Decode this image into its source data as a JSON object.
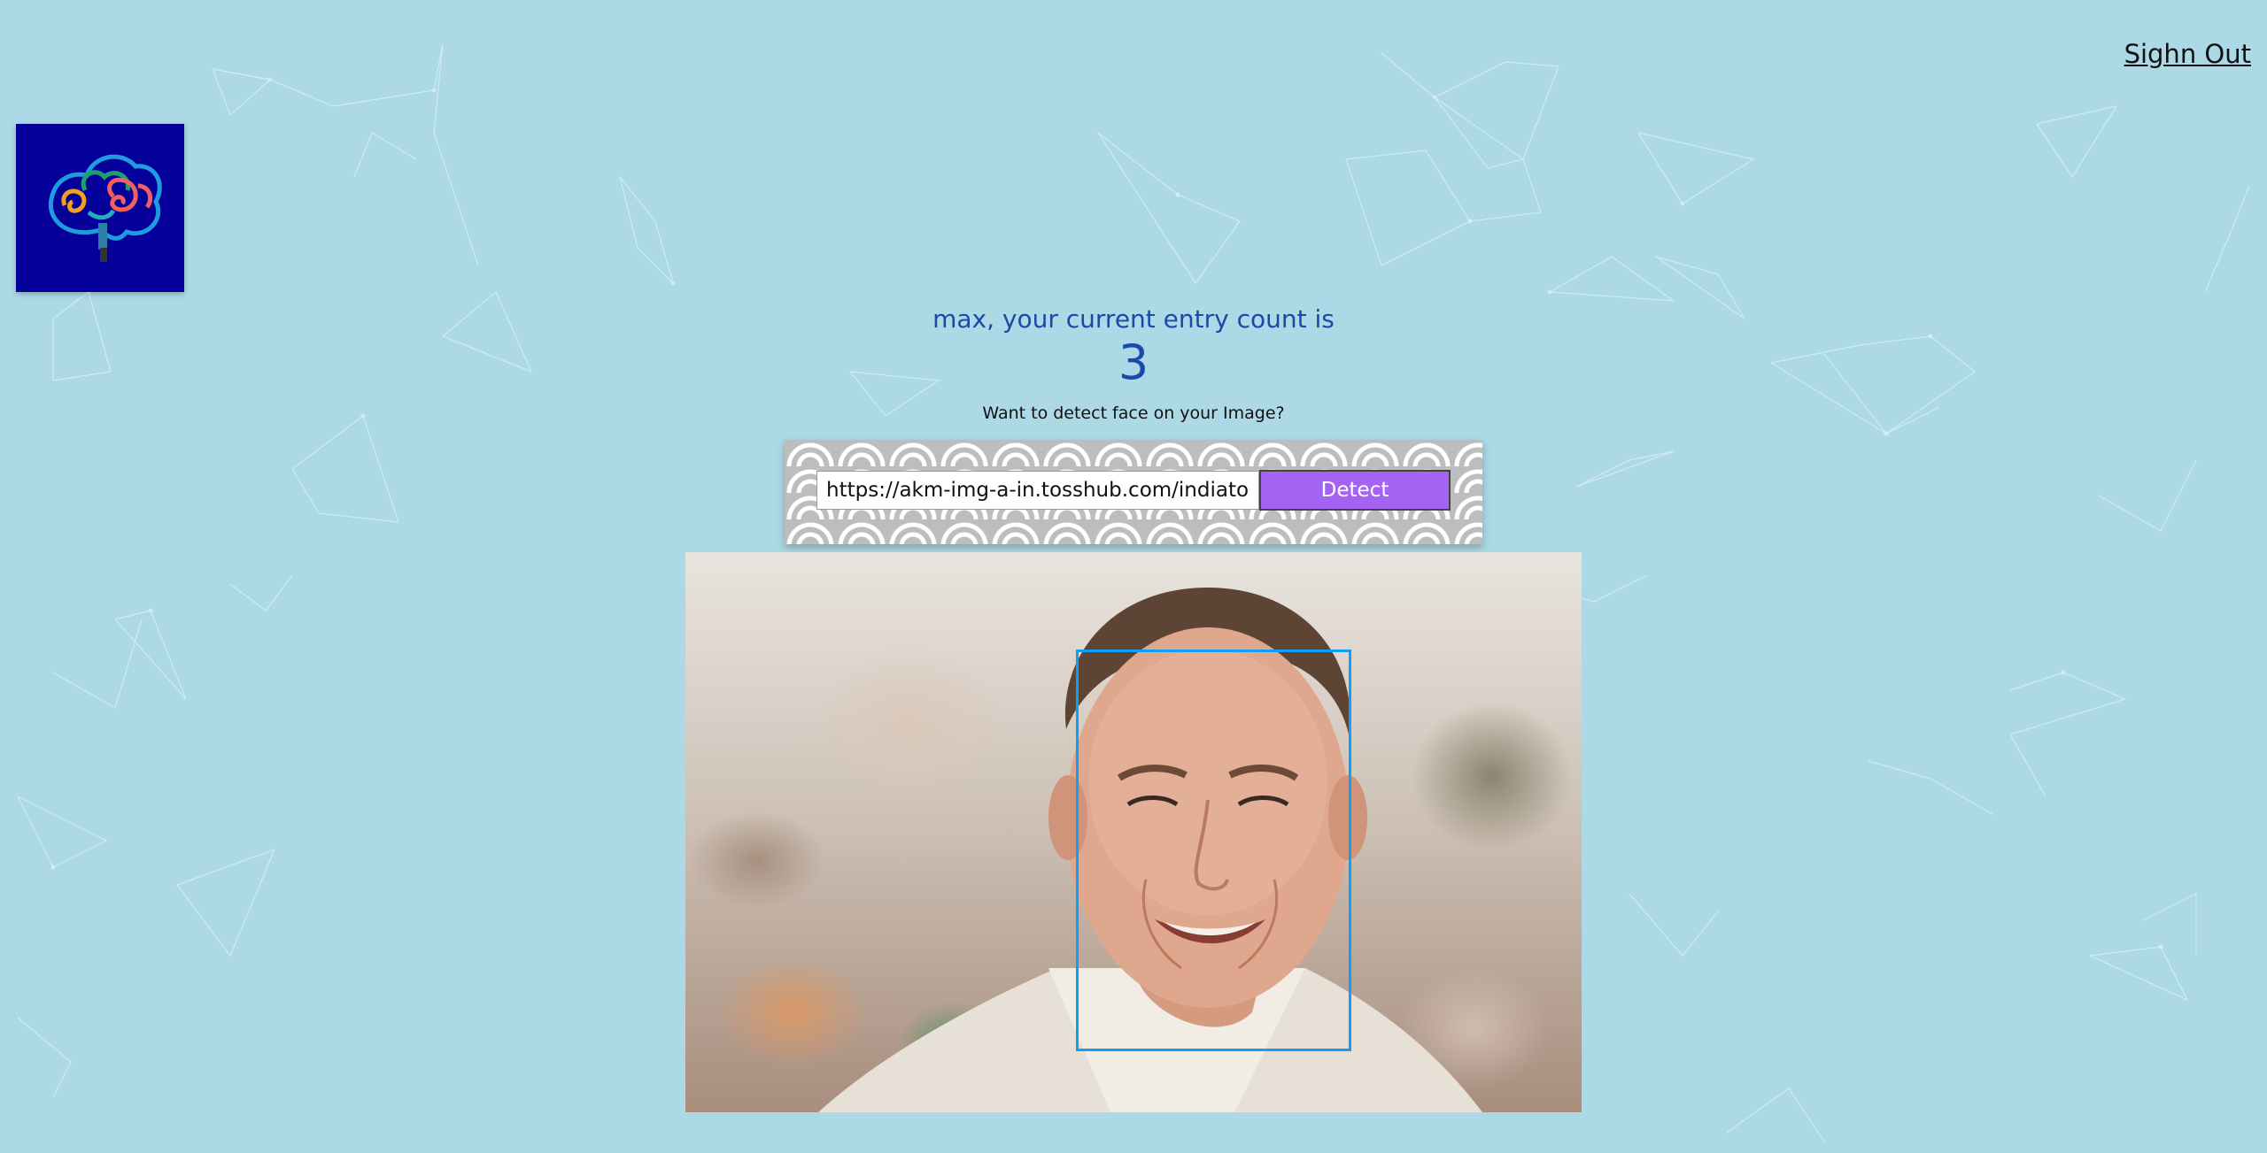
{
  "header": {
    "signout_label": "Sighn Out"
  },
  "logo": {
    "icon": "brain-icon",
    "background": "#06009a"
  },
  "rank": {
    "greeting": "max, your current entry count is",
    "count": "3"
  },
  "form": {
    "prompt": "Want to detect face on your Image?",
    "url_value": "https://akm-img-a-in.tosshub.com/indiatoday/images/story/arnold-schwarzenegger.jpg",
    "detect_label": "Detect"
  },
  "result": {
    "faces_detected": 1
  },
  "colors": {
    "background": "#add8e6",
    "accent": "#a463f2",
    "text_primary": "#1a4aa8",
    "box": "#149df2"
  }
}
